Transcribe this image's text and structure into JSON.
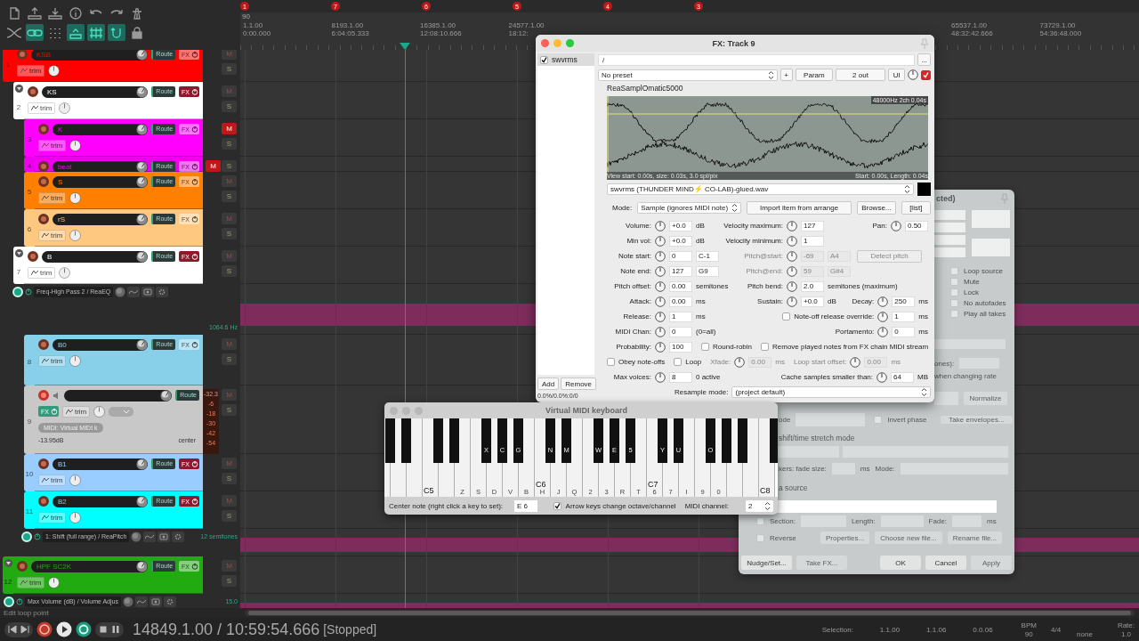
{
  "toolbar": {
    "toggles": [
      {
        "on": false
      },
      {
        "on": true
      },
      {
        "on": false
      },
      {
        "on": true
      },
      {
        "on": true
      },
      {
        "on": true
      },
      {
        "on": false
      }
    ]
  },
  "ruler": {
    "markers": [
      "1",
      "7",
      "6",
      "5",
      "4",
      "3"
    ],
    "tempo": "90",
    "left_labels": [
      {
        "bar": "1.1.00",
        "time": "0:00.000"
      },
      {
        "bar": "8193.1.00",
        "time": "6:04:05.333"
      },
      {
        "bar": "16385.1.00",
        "time": "12:08:10.666"
      },
      {
        "bar": "24577.1.00",
        "time": "18:12:"
      }
    ],
    "right_labels": [
      {
        "bar": "65537.1.00",
        "time": "48:32:42.666"
      },
      {
        "bar": "73729.1.00",
        "time": "54:36:48.000"
      }
    ]
  },
  "tracks": [
    {
      "number": "1",
      "name": "KSB",
      "color": "#ff0000",
      "kind": "audio",
      "compact": false,
      "expanded": false,
      "armed": false,
      "folder_toggle": false,
      "fx_present": false,
      "muted": false,
      "soloed": false,
      "labels": {
        "route": "Route",
        "fx": "FX",
        "trim": "trim",
        "mute": "M",
        "solo": "S"
      },
      "children": [
        {
          "number": "2",
          "name": "KS",
          "color": "#ffffff",
          "kind": "audio",
          "compact": false,
          "expanded": false,
          "armed": false,
          "folder_toggle": true,
          "fx_present": true,
          "muted": false,
          "soloed": false,
          "labels": {
            "route": "Route",
            "fx": "FX",
            "trim": "trim",
            "mute": "M",
            "solo": "S"
          },
          "children": [
            {
              "number": "3",
              "name": "K",
              "color": "#ff00ff",
              "kind": "audio",
              "compact": false,
              "expanded": false,
              "armed": false,
              "folder_toggle": false,
              "fx_present": false,
              "muted": true,
              "soloed": false,
              "labels": {
                "route": "Route",
                "fx": "FX",
                "trim": "trim",
                "mute": "M",
                "solo": "S"
              }
            },
            {
              "number": "4",
              "name": "beat",
              "color": "#ee00ee",
              "kind": "audio",
              "compact": true,
              "expanded": false,
              "armed": false,
              "folder_toggle": false,
              "fx_present": false,
              "muted": true,
              "soloed": false,
              "labels": {
                "route": "Route",
                "fx": "FX",
                "mute": "M",
                "solo": "S"
              }
            },
            {
              "number": "5",
              "name": "S",
              "color": "#ff8000",
              "kind": "audio",
              "compact": false,
              "expanded": false,
              "armed": false,
              "folder_toggle": false,
              "fx_present": false,
              "muted": false,
              "soloed": false,
              "labels": {
                "route": "Route",
                "fx": "FX",
                "trim": "trim",
                "mute": "M",
                "solo": "S"
              }
            },
            {
              "number": "6",
              "name": "rS",
              "color": "#ffc880",
              "kind": "audio",
              "compact": false,
              "expanded": false,
              "armed": false,
              "folder_toggle": false,
              "fx_present": false,
              "muted": false,
              "soloed": false,
              "labels": {
                "route": "Route",
                "fx": "FX",
                "trim": "trim",
                "mute": "M",
                "solo": "S"
              }
            }
          ]
        },
        {
          "number": "7",
          "name": "B",
          "color": "#ffffff",
          "kind": "audio",
          "compact": false,
          "expanded": false,
          "armed": false,
          "folder_toggle": true,
          "fx_present": true,
          "muted": false,
          "soloed": false,
          "labels": {
            "route": "Route",
            "fx": "FX",
            "trim": "trim",
            "mute": "M",
            "solo": "S"
          },
          "envelopes": [
            {
              "label": "Freq-High Pass 2 / ReaEQ",
              "value": "1064.6 Hz",
              "active": true,
              "expanded": true
            }
          ],
          "children": [
            {
              "number": "8",
              "name": "B0",
              "color": "#88d0ea",
              "kind": "audio",
              "compact": false,
              "expanded": true,
              "armed": false,
              "folder_toggle": false,
              "fx_present": false,
              "muted": false,
              "soloed": false,
              "labels": {
                "route": "Route",
                "fx": "FX",
                "trim": "trim",
                "mute": "M",
                "solo": "S"
              }
            },
            {
              "number": "9",
              "color": "#c8c8c8",
              "kind": "midi",
              "armed": true,
              "folder_toggle": false,
              "fx_present": true,
              "muted": false,
              "soloed": false,
              "labels": {
                "route": "Route",
                "fx": "FX",
                "trim": "trim",
                "mute": "M",
                "solo": "S"
              },
              "input": "MIDI: Virtual MIDI k",
              "volume": "-13.95dB",
              "pan": "center",
              "meter": {
                "peak": "-32.3",
                "scale": [
                  "-6",
                  "-18",
                  "-30",
                  "-42",
                  "-54"
                ]
              }
            },
            {
              "number": "10",
              "name": "B1",
              "color": "#99ccff",
              "kind": "audio",
              "compact": false,
              "expanded": false,
              "armed": false,
              "folder_toggle": false,
              "fx_present": true,
              "muted": false,
              "soloed": false,
              "labels": {
                "route": "Route",
                "fx": "FX",
                "trim": "trim",
                "mute": "M",
                "solo": "S"
              }
            },
            {
              "number": "11",
              "name": "B2",
              "color": "#00ffff",
              "kind": "audio",
              "compact": false,
              "expanded": false,
              "armed": false,
              "folder_toggle": false,
              "fx_present": true,
              "muted": false,
              "soloed": false,
              "labels": {
                "route": "Route",
                "fx": "FX",
                "trim": "trim",
                "mute": "M",
                "solo": "S"
              },
              "envelopes": [
                {
                  "label": "1: Shift (full range) / ReaPitch",
                  "value": "12 semitones",
                  "active": true,
                  "expanded": false
                }
              ]
            }
          ]
        }
      ]
    },
    {
      "number": "12",
      "name": "HPF SC2K",
      "color": "#22aa11",
      "kind": "audio",
      "compact": false,
      "expanded": false,
      "armed": false,
      "folder_toggle": true,
      "fx_present": false,
      "muted": false,
      "soloed": false,
      "labels": {
        "route": "Route",
        "fx": "FX",
        "trim": "trim",
        "mute": "M",
        "solo": "S"
      },
      "envelopes": [
        {
          "label": "Max Volume (dB) / Volume Adjus",
          "value": "15.0",
          "active": true,
          "expanded": false
        }
      ]
    }
  ],
  "status_text": "Edit loop point",
  "transport": {
    "position": "14849.1.00 / 10:59:54.666",
    "state": "[Stopped]",
    "repeat": true,
    "selection_label": "Selection:",
    "selection": [
      "1.1.00",
      "1.1.06",
      "0.0.06"
    ],
    "bpm_label": "BPM",
    "bpm": "90",
    "signature": "4/4",
    "sync": "none",
    "rate_label": "Rate:",
    "rate": "1.0"
  },
  "fx_window": {
    "title": "FX: Track 9",
    "chain": [
      {
        "name": "swvrms",
        "enabled": true,
        "selected": true
      }
    ],
    "chain_buttons": [
      "Add",
      "Remove"
    ],
    "cpu": "0.0%/0.0%:0/0",
    "path": "/",
    "path_button": "...",
    "preset": "No preset",
    "preset_buttons": [
      "+",
      "Param",
      "2 out",
      "UI"
    ],
    "enabled": true,
    "plugin": "ReaSamplOmatic5000",
    "waveform": {
      "info": "48000Hz 2ch 0.04s",
      "view": "View start: 0.00s, size: 0.03s, 3.0 spl/pix",
      "range": "Start: 0.00s, Length: 0.04s"
    },
    "file": "swvrms (THUNDER MIND⚡ CO-LAB)-glued.wav",
    "mode_label": "Mode:",
    "mode": "Sample (ignores MIDI note)",
    "mode_buttons": [
      "Import item from arrange",
      "Browse...",
      "[list]"
    ],
    "params": [
      {
        "left": {
          "kind": "param",
          "label": "Volume:",
          "value": "+0.0",
          "unit": "dB"
        },
        "middle": {
          "kind": "param",
          "label": "Velocity maximum:",
          "value": "127"
        },
        "right": {
          "kind": "param",
          "label": "Pan:",
          "value": "0.50"
        }
      },
      {
        "left": {
          "kind": "param",
          "label": "Min vol:",
          "value": "+0.0",
          "unit": "dB"
        },
        "middle": {
          "kind": "param",
          "label": "Velocity minimum:",
          "value": "1"
        }
      },
      {
        "left": {
          "kind": "param",
          "label": "Note start:",
          "value": "0",
          "value2": "C-1"
        },
        "middle": {
          "kind": "param",
          "label": "Pitch@start:",
          "value": "-69",
          "value2": "A4",
          "disabled": true
        },
        "right": {
          "kind": "button",
          "label": "Detect pitch",
          "disabled": true
        }
      },
      {
        "left": {
          "kind": "param",
          "label": "Note end:",
          "value": "127",
          "value2": "G9"
        },
        "middle": {
          "kind": "param",
          "label": "Pitch@end:",
          "value": "59",
          "value2": "G#4",
          "disabled": true
        }
      },
      {
        "left": {
          "kind": "param",
          "label": "Pitch offset:",
          "value": "0.00",
          "unit": "semitones"
        },
        "middle": {
          "kind": "param",
          "label": "Pitch bend:",
          "value": "2.0",
          "unit": "semitones (maximum)"
        }
      },
      {
        "left": {
          "kind": "param",
          "label": "Attack:",
          "value": "0.00",
          "unit": "ms"
        },
        "middle": {
          "kind": "param",
          "label": "Sustain:",
          "value": "+0.0",
          "unit": "dB"
        },
        "right": {
          "kind": "param",
          "label": "Decay:",
          "value": "250",
          "unit": "ms"
        }
      },
      {
        "left": {
          "kind": "param",
          "label": "Release:",
          "value": "1",
          "unit": "ms"
        },
        "right": {
          "kind": "param",
          "label": "Note-off release override:",
          "value": "1",
          "unit": "ms",
          "checked": false
        }
      },
      {
        "left": {
          "kind": "param",
          "label": "MIDI Chan:",
          "value": "0",
          "unit": "(0=all)"
        },
        "right": {
          "kind": "param",
          "label": "Portamento:",
          "value": "0",
          "unit": "ms"
        }
      },
      {
        "items": [
          {
            "kind": "param",
            "label": "Probability:",
            "value": "100"
          },
          {
            "kind": "checkbox",
            "label": "Round-robin",
            "checked": false
          },
          {
            "kind": "checkbox",
            "label": "Remove played notes from FX chain MIDI stream",
            "checked": false
          }
        ]
      },
      {
        "items": [
          {
            "kind": "checkbox",
            "label": "Obey note-offs",
            "checked": false
          },
          {
            "kind": "checkbox",
            "label": "Loop",
            "checked": false
          },
          {
            "kind": "param",
            "label": "Xfade:",
            "value": "0.00",
            "unit": "ms",
            "disabled": true
          },
          {
            "kind": "param",
            "label": "Loop start offset:",
            "value": "0.00",
            "unit": "ms",
            "disabled": true
          }
        ]
      },
      {
        "left": {
          "kind": "param",
          "label": "Max voices:",
          "value": "8",
          "unit": "0 active"
        },
        "right": {
          "kind": "param",
          "label": "Cache samples smaller than:",
          "value": "64",
          "unit": "MB"
        }
      },
      {
        "items": [
          {
            "kind": "select",
            "label": "Resample mode:",
            "value": "(project default)"
          }
        ]
      }
    ]
  },
  "midi_keyboard": {
    "title": "Virtual MIDI keyboard",
    "white_keys": [
      {
        "sharp": true
      },
      {
        "sharp": true
      },
      {
        "sharp": false
      },
      {
        "octave_label": "C5",
        "sharp": true
      },
      {
        "sharp": true
      },
      {
        "key_label": "Z",
        "sharp": false
      },
      {
        "key_label": "S",
        "sharp": true,
        "sharp_label": "X"
      },
      {
        "key_label": "D",
        "sharp": true,
        "sharp_label": "C"
      },
      {
        "key_label": "V",
        "sharp": true,
        "sharp_label": "G"
      },
      {
        "key_label": "B",
        "sharp": false
      },
      {
        "octave_label": "C6",
        "key_label": "H",
        "sharp": true,
        "sharp_label": "N"
      },
      {
        "key_label": "J",
        "sharp": true,
        "sharp_label": "M"
      },
      {
        "key_label": "Q",
        "sharp": false
      },
      {
        "key_label": "2",
        "sharp": true,
        "sharp_label": "W"
      },
      {
        "key_label": "3",
        "sharp": true,
        "sharp_label": "E"
      },
      {
        "key_label": "R",
        "sharp": true,
        "sharp_label": "5"
      },
      {
        "key_label": "T",
        "sharp": false
      },
      {
        "octave_label": "C7",
        "key_label": "6",
        "sharp": true,
        "sharp_label": "Y"
      },
      {
        "key_label": "7",
        "sharp": true,
        "sharp_label": "U"
      },
      {
        "key_label": "I",
        "sharp": false
      },
      {
        "key_label": "9",
        "sharp": true,
        "sharp_label": "O"
      },
      {
        "key_label": "0",
        "sharp": true
      },
      {
        "sharp": true
      },
      {
        "sharp": false
      },
      {
        "octave_label": "C8",
        "sharp": true
      }
    ],
    "center_note_label": "Center note (right click a key to set):",
    "center_note": "E 6",
    "arrow_keys": {
      "label": "Arrow keys change octave/channel",
      "checked": true
    },
    "channel_label": "MIDI channel:",
    "channel": "2"
  },
  "item_dialog": {
    "title": "cted)",
    "checkboxes": [
      {
        "label": "Loop source",
        "checked": false
      },
      {
        "label": "Mute",
        "checked": false
      },
      {
        "label": "Lock",
        "checked": false
      },
      {
        "label": "No autofades",
        "checked": false
      },
      {
        "label": "Play all takes",
        "checked": false
      }
    ],
    "pitch_label": "ones):",
    "rate_note": "when changing rate",
    "normalize": {
      "label": "Normalize",
      "disabled": true
    },
    "mode_label": "ode",
    "invert_phase": {
      "label": "Invert phase",
      "checked": false
    },
    "take_envelopes": {
      "label": "Take envelopes...",
      "disabled": true
    },
    "stretch_heading": "shift/time stretch mode",
    "fade_label": "kers: fade size:",
    "fade_unit": "ms",
    "stretch_mode_label": "Mode:",
    "source_heading": "a source",
    "section": {
      "label": "Section:",
      "checked": false
    },
    "length_label": "Length:",
    "fade2_label": "Fade:",
    "fade2_unit": "ms",
    "reverse": {
      "label": "Reverse",
      "checked": false
    },
    "source_buttons": [
      {
        "label": "Properties...",
        "disabled": true
      },
      {
        "label": "Choose new file...",
        "disabled": true
      },
      {
        "label": "Rename file...",
        "disabled": true
      }
    ],
    "buttons": [
      {
        "label": "Nudge/Set...",
        "disabled": false
      },
      {
        "label": "Take FX...",
        "disabled": true
      },
      {
        "label": "OK",
        "disabled": false
      },
      {
        "label": "Cancel",
        "disabled": false
      },
      {
        "label": "Apply",
        "disabled": true
      }
    ]
  }
}
